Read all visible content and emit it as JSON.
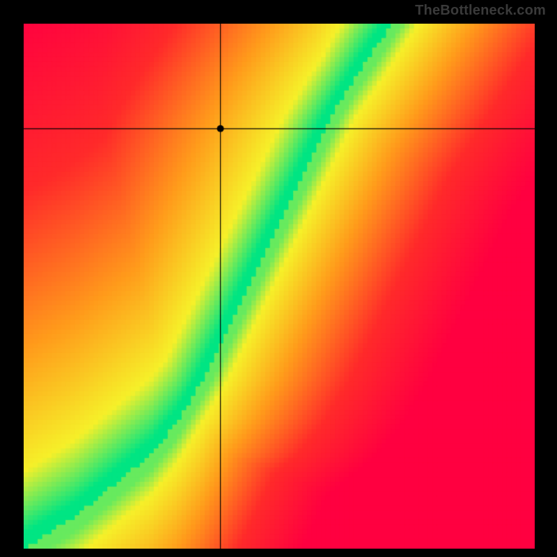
{
  "watermark": "TheBottleneck.com",
  "chart_data": {
    "type": "heatmap",
    "title": "",
    "xlabel": "",
    "ylabel": "",
    "x_range": [
      0,
      1
    ],
    "y_range": [
      0,
      1
    ],
    "crosshair": {
      "x": 0.385,
      "y": 0.8
    },
    "marker": {
      "x": 0.385,
      "y": 0.8
    },
    "optimal_curve": [
      {
        "x": 0.0,
        "y": 0.0
      },
      {
        "x": 0.05,
        "y": 0.03
      },
      {
        "x": 0.1,
        "y": 0.06
      },
      {
        "x": 0.15,
        "y": 0.1
      },
      {
        "x": 0.2,
        "y": 0.14
      },
      {
        "x": 0.25,
        "y": 0.18
      },
      {
        "x": 0.3,
        "y": 0.24
      },
      {
        "x": 0.35,
        "y": 0.32
      },
      {
        "x": 0.4,
        "y": 0.42
      },
      {
        "x": 0.45,
        "y": 0.52
      },
      {
        "x": 0.5,
        "y": 0.62
      },
      {
        "x": 0.55,
        "y": 0.72
      },
      {
        "x": 0.6,
        "y": 0.82
      },
      {
        "x": 0.65,
        "y": 0.9
      },
      {
        "x": 0.7,
        "y": 0.97
      },
      {
        "x": 0.72,
        "y": 1.0
      }
    ],
    "band_width": 0.055,
    "colors": {
      "optimal": "#00e583",
      "near": "#f6f029",
      "mid": "#ff9b1b",
      "far": "#ff2a2a",
      "worst": "#ff0040"
    }
  }
}
